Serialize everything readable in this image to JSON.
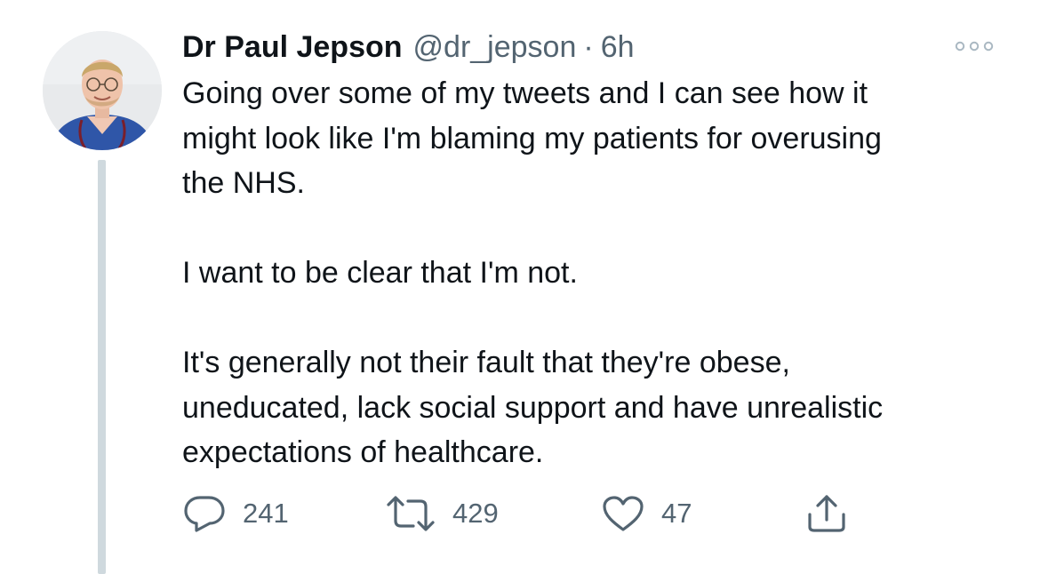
{
  "tweet": {
    "author": {
      "display_name": "Dr Paul Jepson",
      "handle": "@dr_jepson"
    },
    "separator": "·",
    "time": "6h",
    "text": "Going over some of my tweets and I can see how it\nmight look like I'm blaming my patients for overusing\nthe NHS.\n\nI want to be clear that I'm not.\n\nIt's generally not their fault that they're obese,\nuneducated, lack social support and have unrealistic\nexpectations of healthcare.",
    "stats": {
      "replies": "241",
      "retweets": "429",
      "likes": "47"
    }
  },
  "icons": {
    "more": "more-horizontal-icon",
    "reply": "speech-bubble-icon",
    "retweet": "retweet-icon",
    "like": "heart-icon",
    "share": "share-upload-icon"
  },
  "colors": {
    "text": "#0f1419",
    "secondary": "#536471",
    "thread_line": "#cfd9de",
    "more_dots": "#aab8c2"
  }
}
